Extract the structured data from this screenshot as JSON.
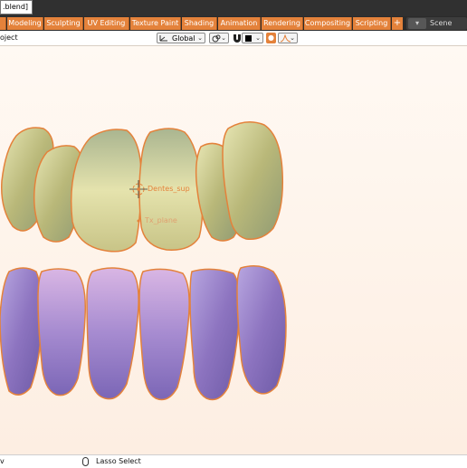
{
  "window": {
    "file_title": ".blend]"
  },
  "workspace_tabs": [
    {
      "label": "Modeling"
    },
    {
      "label": "Sculpting"
    },
    {
      "label": "UV Editing"
    },
    {
      "label": "Texture Paint"
    },
    {
      "label": "Shading"
    },
    {
      "label": "Animation"
    },
    {
      "label": "Rendering"
    },
    {
      "label": "Compositing"
    },
    {
      "label": "Scripting"
    }
  ],
  "add_workspace": "+",
  "scene": {
    "label": "Scene",
    "icon": "scene-icon"
  },
  "header": {
    "mode_label": "oject",
    "pivot": "Global",
    "transform_pivot_icon": "orientation-icon",
    "snap_icon": "snap-icon",
    "proportional_icon": "proportional-edit-icon",
    "falloff_icon": "falloff-curve-icon"
  },
  "viewport": {
    "objects": [
      {
        "label": "Dentes_sup",
        "selected": true
      },
      {
        "label": "Tx_plane",
        "selected": false
      }
    ],
    "colors": {
      "upper_teeth": "#c9c88c",
      "lower_teeth": "#a48bc8",
      "outline": "#e4823b"
    }
  },
  "status": {
    "left": "v",
    "hint": "Lasso Select",
    "hint_icon": "mouse-icon"
  }
}
